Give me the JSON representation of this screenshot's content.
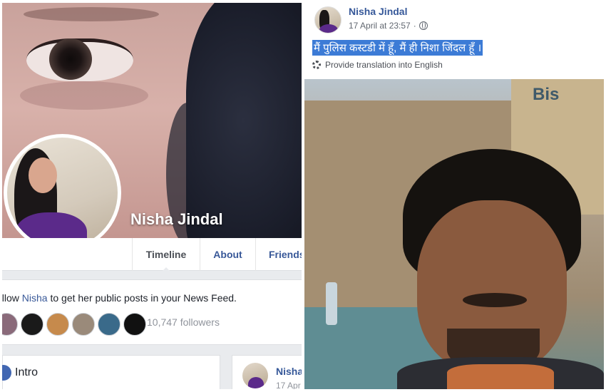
{
  "profile": {
    "name": "Nisha Jindal",
    "tabs": [
      {
        "label": "Timeline",
        "active": true
      },
      {
        "label": "About",
        "active": false
      },
      {
        "label": "Friends",
        "active": false
      }
    ],
    "follow_prefix": "ollow ",
    "follow_name": "Nisha",
    "follow_suffix": " to get her public posts in your News Feed.",
    "followers_count": "10,747 followers",
    "intro_label": "Intro",
    "mini_post": {
      "name": "Nisha",
      "date": "17 Apr"
    }
  },
  "post": {
    "author": "Nisha Jindal",
    "timestamp": "17 April at 23:57",
    "privacy_icon": "globe-icon",
    "text": "मैं पुलिस कस्टडी में हूँ, मैं ही निशा जिंदल हूँ ।",
    "translate_link": "Provide translation into English",
    "brand_on_box": "Bis"
  },
  "colors": {
    "facebook_blue": "#385898",
    "link_blue": "#365899",
    "highlight": "#3c7bd6",
    "page_bg": "#e9ebee"
  }
}
